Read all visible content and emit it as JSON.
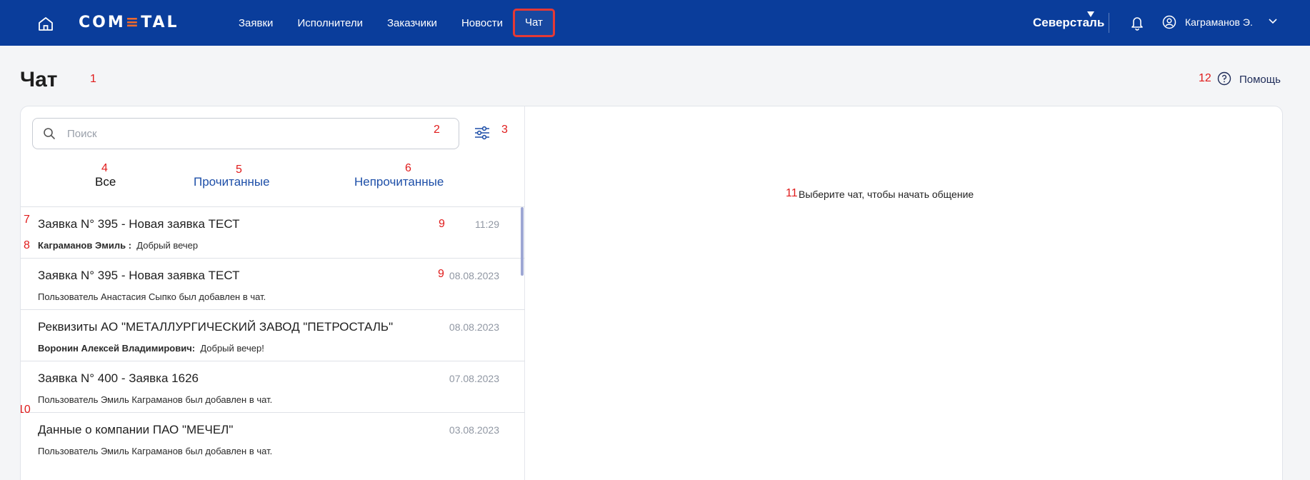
{
  "header": {
    "logo_text": "COMETAL",
    "logo_prefix": "COM",
    "logo_bar": "≡",
    "logo_suffix": "TAL",
    "nav": [
      "Заявки",
      "Исполнители",
      "Заказчики",
      "Новости",
      "Чат"
    ],
    "active_nav": "Чат",
    "brand": "Северсталь",
    "user": "Каграманов Э.",
    "accent_color": "#0a3d9b",
    "highlight_color": "#e53935"
  },
  "page": {
    "title": "Чат",
    "help": "Помощь"
  },
  "search": {
    "placeholder": "Поиск",
    "value": ""
  },
  "tabs": [
    "Все",
    "Прочитанные",
    "Непрочитанные"
  ],
  "chats": [
    {
      "title": "Заявка N° 395 - Новая заявка ТЕСТ",
      "date": "11:29",
      "sender": "Каграманов Эмиль :",
      "text": "Добрый вечер"
    },
    {
      "title": "Заявка N° 395 - Новая заявка ТЕСТ",
      "date": "08.08.2023",
      "sender": "",
      "text": "Пользователь Анастасия Сыпко был добавлен в чат."
    },
    {
      "title": "Реквизиты АО \"МЕТАЛЛУРГИЧЕСКИЙ ЗАВОД \"ПЕТРОСТАЛЬ\"",
      "date": "08.08.2023",
      "sender": "Воронин Алексей Владимирович:",
      "text": "Добрый вечер!"
    },
    {
      "title": "Заявка N° 400 - Заявка 1626",
      "date": "07.08.2023",
      "sender": "",
      "text": "Пользователь Эмиль Каграманов был добавлен в чат."
    },
    {
      "title": "Данные о компании ПАО \"МЕЧЕЛ\"",
      "date": "03.08.2023",
      "sender": "",
      "text": "Пользователь Эмиль Каграманов был добавлен в чат."
    }
  ],
  "empty_state": "Выберите чат, чтобы начать общение",
  "annotations": [
    "1",
    "2",
    "3",
    "4",
    "5",
    "6",
    "7",
    "8",
    "9",
    "9",
    "10",
    "11",
    "12"
  ]
}
